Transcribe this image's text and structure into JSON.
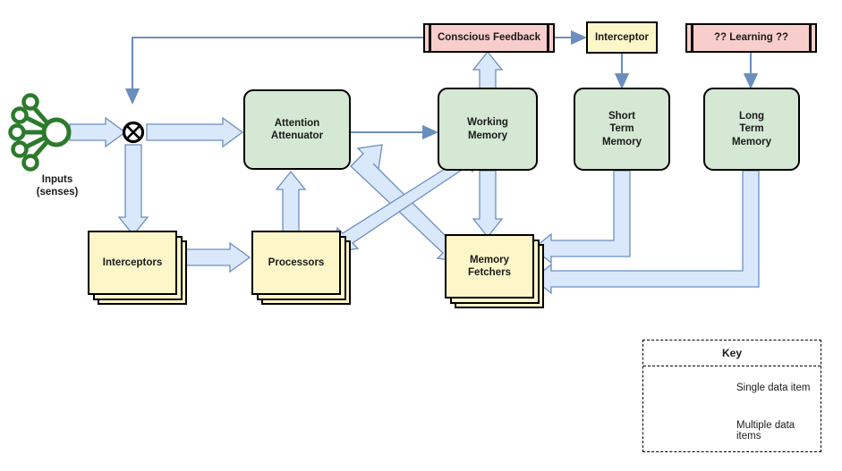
{
  "diagram": {
    "title": "Cognitive architecture data flow diagram",
    "colors": {
      "green_fill": "#d5e8d4",
      "yellow_fill": "#fdf6c8",
      "pink_fill": "#f8cecc",
      "arrow_fill": "#dae8fc",
      "arrow_stroke": "#6c8ebf",
      "thin_arrow": "#6c8ebf",
      "node_border": "#000000",
      "sensor_green": "#2d7a2d"
    }
  },
  "inputs": {
    "icon": "sensor-hub-icon",
    "caption_line1": "Inputs",
    "caption_line2": "(senses)"
  },
  "junction": {
    "icon": "crossed-circle-icon",
    "label": "merge junction"
  },
  "nodes": {
    "attention_attenuator": {
      "label": "Attention\nAttenuator",
      "line1": "Attention",
      "line2": "Attenuator",
      "shape": "rounded",
      "fill": "#d5e8d4"
    },
    "working_memory": {
      "line1": "Working",
      "line2": "Memory",
      "shape": "rounded",
      "fill": "#d5e8d4"
    },
    "short_term_memory": {
      "line1": "Short",
      "line2": "Term",
      "line3": "Memory",
      "shape": "rounded",
      "fill": "#d5e8d4"
    },
    "long_term_memory": {
      "line1": "Long",
      "line2": "Term",
      "line3": "Memory",
      "shape": "rounded",
      "fill": "#d5e8d4"
    },
    "conscious_feedback": {
      "label": "Conscious Feedback",
      "shape": "subroutine",
      "fill": "#f8cecc"
    },
    "interceptor": {
      "label": "Interceptor",
      "shape": "rectangle",
      "fill": "#fdf6c8"
    },
    "learning": {
      "label": "?? Learning ??",
      "shape": "subroutine",
      "fill": "#f8cecc"
    },
    "interceptors_stack": {
      "label": "Interceptors",
      "shape": "stacked",
      "fill": "#fdf6c8"
    },
    "processors_stack": {
      "label": "Processors",
      "shape": "stacked",
      "fill": "#fdf6c8"
    },
    "memory_fetchers_stack": {
      "line1": "Memory",
      "line2": "Fetchers",
      "shape": "stacked",
      "fill": "#fdf6c8"
    }
  },
  "key": {
    "title": "Key",
    "rows": [
      {
        "sample": "thin-arrow-icon",
        "label": "Single data item"
      },
      {
        "sample": "block-arrow-icon",
        "label": "Multiple data items"
      }
    ]
  }
}
